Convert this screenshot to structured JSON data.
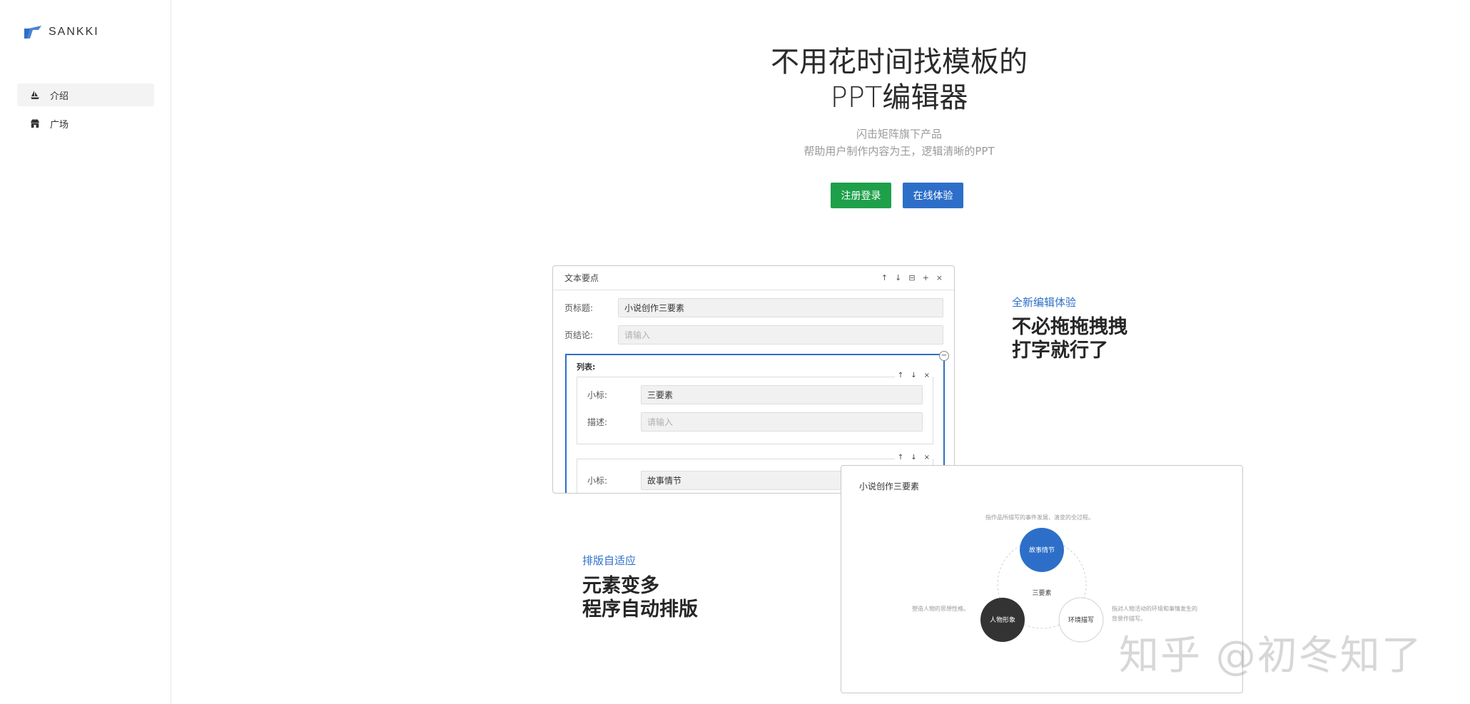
{
  "brand": {
    "name": "SANKKI"
  },
  "sidebar": {
    "items": [
      {
        "label": "介绍",
        "icon": "boat-icon",
        "active": true
      },
      {
        "label": "广场",
        "icon": "store-icon",
        "active": false
      }
    ]
  },
  "hero": {
    "title_line1": "不用花时间找模板的",
    "title_line2": "PPT编辑器",
    "sub_line1": "闪击矩阵旗下产品",
    "sub_line2": "帮助用户制作内容为王，逻辑清晰的PPT",
    "register_label": "注册登录",
    "try_label": "在线体验"
  },
  "editor": {
    "title": "文本要点",
    "page_title_label": "页标题:",
    "page_title_value": "小说创作三要素",
    "page_conclusion_label": "页结论:",
    "page_conclusion_placeholder": "请输入",
    "list_label": "列表:",
    "items": [
      {
        "sub_label": "小标:",
        "sub_value": "三要素",
        "desc_label": "描述:",
        "desc_placeholder": "请输入"
      },
      {
        "sub_label": "小标:",
        "sub_value": "故事情节"
      }
    ]
  },
  "feature1": {
    "tag": "全新编辑体验",
    "line1": "不必拖拖拽拽",
    "line2": "打字就行了"
  },
  "feature2": {
    "tag": "排版自适应",
    "line1": "元素变多",
    "line2": "程序自动排版"
  },
  "slide": {
    "title": "小说创作三要素",
    "center": "三要素",
    "nodes": [
      {
        "label": "故事情节",
        "color": "#2d6fc8"
      },
      {
        "label": "人物形象",
        "color": "#333333"
      },
      {
        "label": "环境描写",
        "color": "#ffffff"
      }
    ],
    "caption_top": "指作品所描写的事件发展、演变的全过程。",
    "caption_left": "塑造人物的思想性格。",
    "caption_right_1": "指对人物活动的环境和事情发生的",
    "caption_right_2": "背景作描写。"
  },
  "watermark": "知乎 @初冬知了"
}
